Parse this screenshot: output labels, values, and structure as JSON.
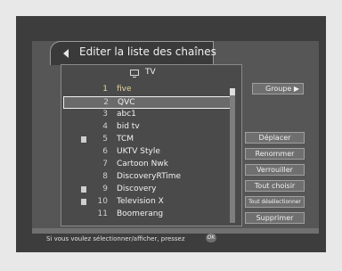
{
  "header": {
    "title": "Editer la liste des chaînes"
  },
  "list": {
    "label": "TV",
    "channels": [
      {
        "num": "1",
        "name": "five",
        "locked": false,
        "selected": true,
        "focused": false
      },
      {
        "num": "2",
        "name": "QVC",
        "locked": false,
        "selected": false,
        "focused": true
      },
      {
        "num": "3",
        "name": "abc1",
        "locked": false,
        "selected": false,
        "focused": false
      },
      {
        "num": "4",
        "name": "bid tv",
        "locked": false,
        "selected": false,
        "focused": false
      },
      {
        "num": "5",
        "name": "TCM",
        "locked": true,
        "selected": false,
        "focused": false
      },
      {
        "num": "6",
        "name": "UKTV Style",
        "locked": false,
        "selected": false,
        "focused": false
      },
      {
        "num": "7",
        "name": "Cartoon Nwk",
        "locked": false,
        "selected": false,
        "focused": false
      },
      {
        "num": "8",
        "name": "DiscoveryRTime",
        "locked": false,
        "selected": false,
        "focused": false
      },
      {
        "num": "9",
        "name": "Discovery",
        "locked": true,
        "selected": false,
        "focused": false
      },
      {
        "num": "10",
        "name": "Television X",
        "locked": true,
        "selected": false,
        "focused": false
      },
      {
        "num": "11",
        "name": "Boomerang",
        "locked": false,
        "selected": false,
        "focused": false
      }
    ]
  },
  "buttons": {
    "groupe": "Groupe",
    "deplacer": "Déplacer",
    "renommer": "Renommer",
    "verrouiller": "Verrouiller",
    "tout_choisir": "Tout choisir",
    "tout_deselectionner": "Tout désélectionner",
    "supprimer": "Supprimer"
  },
  "footer": {
    "hint": "Si vous voulez sélectionner/afficher, pressez",
    "ok_key": "OK"
  }
}
